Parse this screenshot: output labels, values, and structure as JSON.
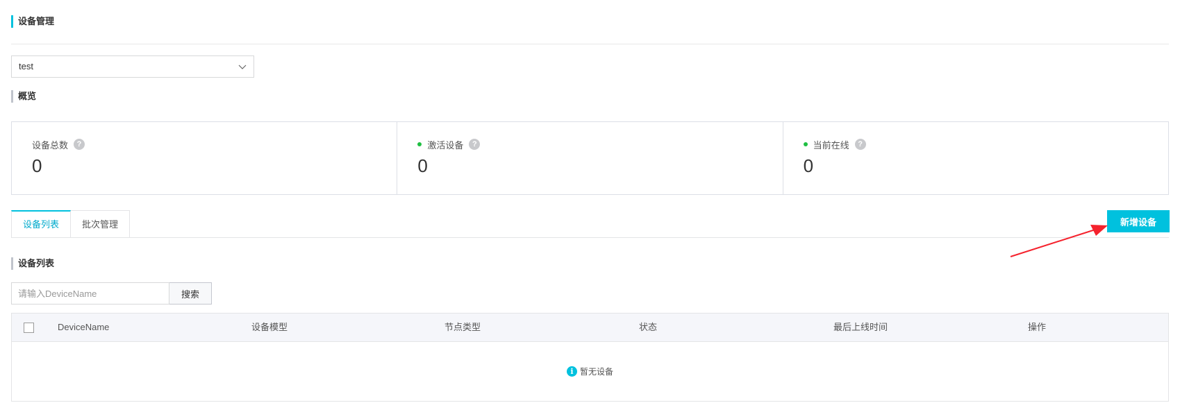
{
  "page": {
    "title": "设备管理"
  },
  "product_select": {
    "value": "test"
  },
  "overview": {
    "title": "概览",
    "cards": [
      {
        "label": "设备总数",
        "value": "0",
        "dot": false
      },
      {
        "label": "激活设备",
        "value": "0",
        "dot": true
      },
      {
        "label": "当前在线",
        "value": "0",
        "dot": true
      }
    ]
  },
  "tabs": [
    {
      "label": "设备列表",
      "active": true
    },
    {
      "label": "批次管理",
      "active": false
    }
  ],
  "add_button": {
    "label": "新增设备"
  },
  "list": {
    "title": "设备列表",
    "search_placeholder": "请输入DeviceName",
    "search_button": "搜索",
    "columns": [
      "DeviceName",
      "设备模型",
      "节点类型",
      "状态",
      "最后上线时间",
      "操作"
    ],
    "empty_text": "暂无设备"
  },
  "colors": {
    "accent": "#00c1de",
    "online_dot": "#1fbf42",
    "arrow": "#f5222d"
  },
  "icons": {
    "select": "chevron-down-icon",
    "help": "question-circle-icon",
    "empty": "info-circle-icon"
  }
}
